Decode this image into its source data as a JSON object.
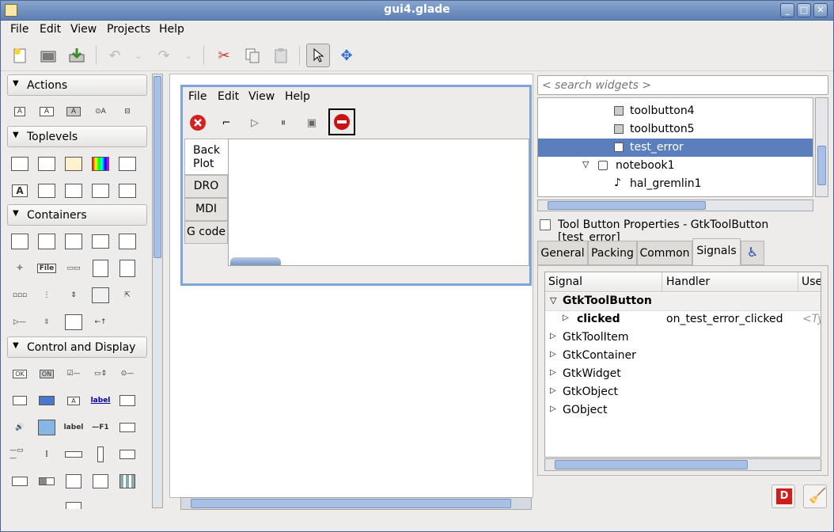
{
  "window": {
    "title": "gui4.glade"
  },
  "menu": [
    "File",
    "Edit",
    "View",
    "Projects",
    "Help"
  ],
  "toolbar_icons": [
    "new-icon",
    "open-icon",
    "save-icon",
    "undo-icon",
    "redo-icon",
    "cut-icon",
    "copy-icon",
    "paste-icon",
    "select-icon",
    "drag-resize-icon"
  ],
  "palette": {
    "sections": [
      "Actions",
      "Toplevels",
      "Containers",
      "Control and Display"
    ],
    "file_label": "File",
    "label_text": "label",
    "f1_text": "F1",
    "ok_text": "OK",
    "on_text": "ON"
  },
  "design": {
    "menu": [
      "File",
      "Edit",
      "View",
      "Help"
    ],
    "tabs": [
      "Back\nPlot",
      "DRO",
      "MDI",
      "G code"
    ]
  },
  "inspector": {
    "search_placeholder": "< search widgets >",
    "tree": [
      "toolbutton4",
      "toolbutton5",
      "test_error",
      "notebook1",
      "hal_gremlin1"
    ],
    "selected": "test_error"
  },
  "properties": {
    "title": "Tool Button Properties - GtkToolButton [test_error]",
    "tabs": [
      "General",
      "Packing",
      "Common",
      "Signals"
    ],
    "active_tab": "Signals",
    "columns": [
      "Signal",
      "Handler",
      "Use"
    ],
    "rows": [
      {
        "name": "GtkToolButton",
        "bold": true,
        "expanded": true
      },
      {
        "name": "clicked",
        "handler": "on_test_error_clicked",
        "use": "<Ty",
        "bold": true
      },
      {
        "name": "GtkToolItem"
      },
      {
        "name": "GtkContainer"
      },
      {
        "name": "GtkWidget"
      },
      {
        "name": "GtkObject"
      },
      {
        "name": "GObject"
      }
    ]
  },
  "colors": {
    "selection": "#5b7fbd",
    "titlebar": "#6d8cc0"
  }
}
